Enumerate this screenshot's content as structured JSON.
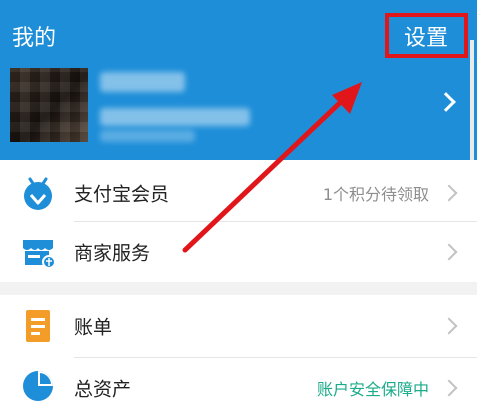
{
  "header": {
    "title": "我的",
    "settings_label": "设置",
    "bg_color": "#1e8ed8"
  },
  "profile": {
    "avatar": "blurred-user-avatar"
  },
  "section1": {
    "items": [
      {
        "label": "支付宝会员",
        "value": "1个积分待领取",
        "icon": "member-badge-icon"
      },
      {
        "label": "商家服务",
        "value": "",
        "icon": "merchant-store-icon"
      }
    ]
  },
  "section2": {
    "items": [
      {
        "label": "账单",
        "value": "",
        "icon": "bill-icon"
      },
      {
        "label": "总资产",
        "value": "账户安全保障中",
        "icon": "assets-pie-icon"
      }
    ]
  },
  "annotation": {
    "highlight_color": "#e0161b"
  }
}
